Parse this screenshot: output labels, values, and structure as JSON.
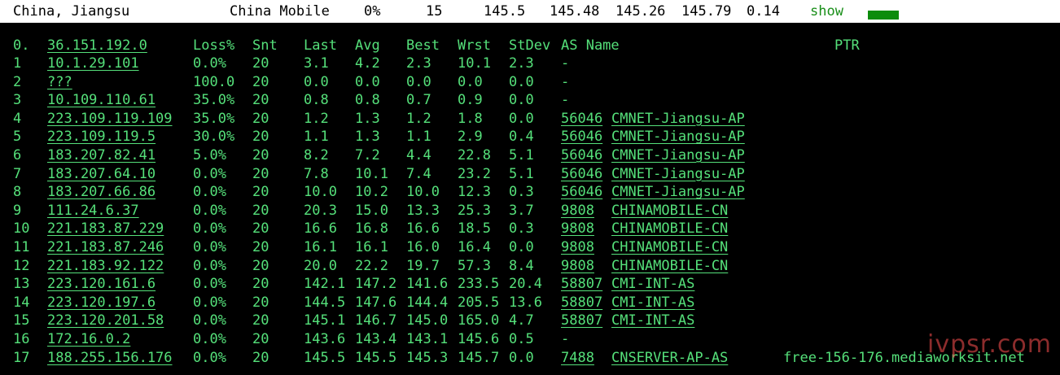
{
  "header": {
    "location": "China, Jiangsu",
    "isp": "China Mobile",
    "loss": "0%",
    "snt": "15",
    "last": "145.5",
    "avg": "145.48",
    "best": "145.26",
    "wrst": "145.79",
    "stdev": "0.14",
    "show_label": "show",
    "accent_color": "#0c8c0c"
  },
  "columns": {
    "idx": "0.",
    "host": "36.151.192.0",
    "loss": "Loss%",
    "snt": "Snt",
    "last": "Last",
    "avg": "Avg",
    "best": "Best",
    "wrst": "Wrst",
    "stdev": "StDev",
    "as_name": "AS Name",
    "ptr": "PTR"
  },
  "rows": [
    {
      "idx": "1",
      "host": "10.1.29.101",
      "loss": "0.0%",
      "snt": "20",
      "last": "3.1",
      "avg": "4.2",
      "best": "2.3",
      "wrst": "10.1",
      "stdev": "2.3",
      "asn": "-",
      "as": "",
      "ptr": ""
    },
    {
      "idx": "2",
      "host": "???",
      "loss": "100.0",
      "snt": "20",
      "last": "0.0",
      "avg": "0.0",
      "best": "0.0",
      "wrst": "0.0",
      "stdev": "0.0",
      "asn": "-",
      "as": "",
      "ptr": ""
    },
    {
      "idx": "3",
      "host": "10.109.110.61",
      "loss": "35.0%",
      "snt": "20",
      "last": "0.8",
      "avg": "0.8",
      "best": "0.7",
      "wrst": "0.9",
      "stdev": "0.0",
      "asn": "-",
      "as": "",
      "ptr": ""
    },
    {
      "idx": "4",
      "host": "223.109.119.109",
      "loss": "35.0%",
      "snt": "20",
      "last": "1.2",
      "avg": "1.3",
      "best": "1.2",
      "wrst": "1.8",
      "stdev": "0.0",
      "asn": "56046",
      "as": "CMNET-Jiangsu-AP",
      "ptr": ""
    },
    {
      "idx": "5",
      "host": "223.109.119.5",
      "loss": "30.0%",
      "snt": "20",
      "last": "1.1",
      "avg": "1.3",
      "best": "1.1",
      "wrst": "2.9",
      "stdev": "0.4",
      "asn": "56046",
      "as": "CMNET-Jiangsu-AP",
      "ptr": ""
    },
    {
      "idx": "6",
      "host": "183.207.82.41",
      "loss": "5.0%",
      "snt": "20",
      "last": "8.2",
      "avg": "7.2",
      "best": "4.4",
      "wrst": "22.8",
      "stdev": "5.1",
      "asn": "56046",
      "as": "CMNET-Jiangsu-AP",
      "ptr": ""
    },
    {
      "idx": "7",
      "host": "183.207.64.10",
      "loss": "0.0%",
      "snt": "20",
      "last": "7.8",
      "avg": "10.1",
      "best": "7.4",
      "wrst": "23.2",
      "stdev": "5.1",
      "asn": "56046",
      "as": "CMNET-Jiangsu-AP",
      "ptr": ""
    },
    {
      "idx": "8",
      "host": "183.207.66.86",
      "loss": "0.0%",
      "snt": "20",
      "last": "10.0",
      "avg": "10.2",
      "best": "10.0",
      "wrst": "12.3",
      "stdev": "0.3",
      "asn": "56046",
      "as": "CMNET-Jiangsu-AP",
      "ptr": ""
    },
    {
      "idx": "9",
      "host": "111.24.6.37",
      "loss": "0.0%",
      "snt": "20",
      "last": "20.3",
      "avg": "15.0",
      "best": "13.3",
      "wrst": "25.3",
      "stdev": "3.7",
      "asn": "9808",
      "as": "CHINAMOBILE-CN",
      "ptr": ""
    },
    {
      "idx": "10",
      "host": "221.183.87.229",
      "loss": "0.0%",
      "snt": "20",
      "last": "16.6",
      "avg": "16.8",
      "best": "16.6",
      "wrst": "18.5",
      "stdev": "0.3",
      "asn": "9808",
      "as": "CHINAMOBILE-CN",
      "ptr": ""
    },
    {
      "idx": "11",
      "host": "221.183.87.246",
      "loss": "0.0%",
      "snt": "20",
      "last": "16.1",
      "avg": "16.1",
      "best": "16.0",
      "wrst": "16.4",
      "stdev": "0.0",
      "asn": "9808",
      "as": "CHINAMOBILE-CN",
      "ptr": ""
    },
    {
      "idx": "12",
      "host": "221.183.92.122",
      "loss": "0.0%",
      "snt": "20",
      "last": "20.0",
      "avg": "22.2",
      "best": "19.7",
      "wrst": "57.3",
      "stdev": "8.4",
      "asn": "9808",
      "as": "CHINAMOBILE-CN",
      "ptr": ""
    },
    {
      "idx": "13",
      "host": "223.120.161.6",
      "loss": "0.0%",
      "snt": "20",
      "last": "142.1",
      "avg": "147.2",
      "best": "141.6",
      "wrst": "233.5",
      "stdev": "20.4",
      "asn": "58807",
      "as": "CMI-INT-AS",
      "ptr": ""
    },
    {
      "idx": "14",
      "host": "223.120.197.6",
      "loss": "0.0%",
      "snt": "20",
      "last": "144.5",
      "avg": "147.6",
      "best": "144.4",
      "wrst": "205.5",
      "stdev": "13.6",
      "asn": "58807",
      "as": "CMI-INT-AS",
      "ptr": ""
    },
    {
      "idx": "15",
      "host": "223.120.201.58",
      "loss": "0.0%",
      "snt": "20",
      "last": "145.1",
      "avg": "146.7",
      "best": "145.0",
      "wrst": "165.0",
      "stdev": "4.7",
      "asn": "58807",
      "as": "CMI-INT-AS",
      "ptr": ""
    },
    {
      "idx": "16",
      "host": "172.16.0.2",
      "loss": "0.0%",
      "snt": "20",
      "last": "143.6",
      "avg": "143.4",
      "best": "143.1",
      "wrst": "145.6",
      "stdev": "0.5",
      "asn": "-",
      "as": "",
      "ptr": ""
    },
    {
      "idx": "17",
      "host": "188.255.156.176",
      "loss": "0.0%",
      "snt": "20",
      "last": "145.5",
      "avg": "145.5",
      "best": "145.3",
      "wrst": "145.7",
      "stdev": "0.0",
      "asn": "7488",
      "as": "CNSERVER-AP-AS",
      "ptr": "free-156-176.mediaworksit.net"
    }
  ],
  "watermark": "ivpsr.com",
  "colors": {
    "background": "#000000",
    "text": "#55e07a",
    "header_bg": "#ffffff"
  }
}
